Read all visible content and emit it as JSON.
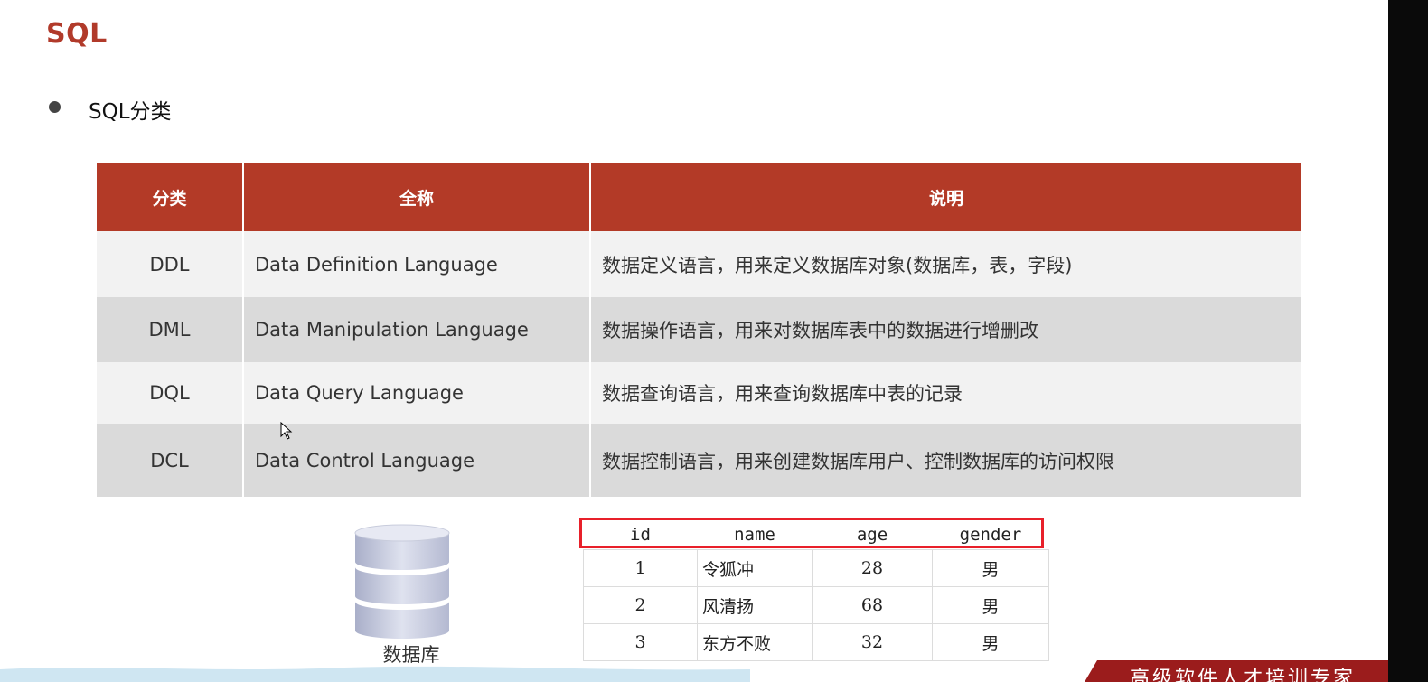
{
  "page": {
    "title": "SQL"
  },
  "section": {
    "bullet": "SQL分类"
  },
  "main_table": {
    "headers": [
      "分类",
      "全称",
      "说明"
    ],
    "rows": [
      {
        "code": "DDL",
        "full": "Data Definition Language",
        "desc": "数据定义语言，用来定义数据库对象(数据库，表，字段)"
      },
      {
        "code": "DML",
        "full": "Data Manipulation Language",
        "desc": "数据操作语言，用来对数据库表中的数据进行增删改"
      },
      {
        "code": "DQL",
        "full": "Data Query Language",
        "desc": "数据查询语言，用来查询数据库中表的记录"
      },
      {
        "code": "DCL",
        "full": "Data Control Language",
        "desc": "数据控制语言，用来创建数据库用户、控制数据库的访问权限"
      }
    ]
  },
  "database": {
    "label": "数据库"
  },
  "sample_table": {
    "headers": [
      "id",
      "name",
      "age",
      "gender"
    ],
    "rows": [
      [
        "1",
        "令狐冲",
        "28",
        "男"
      ],
      [
        "2",
        "风清扬",
        "68",
        "男"
      ],
      [
        "3",
        "东方不败",
        "32",
        "男"
      ]
    ]
  },
  "footer": {
    "banner": "高级软件人才培训专家"
  },
  "colors": {
    "accent": "#b33a27",
    "title": "#b13a2a",
    "highlight": "#e8202a"
  }
}
